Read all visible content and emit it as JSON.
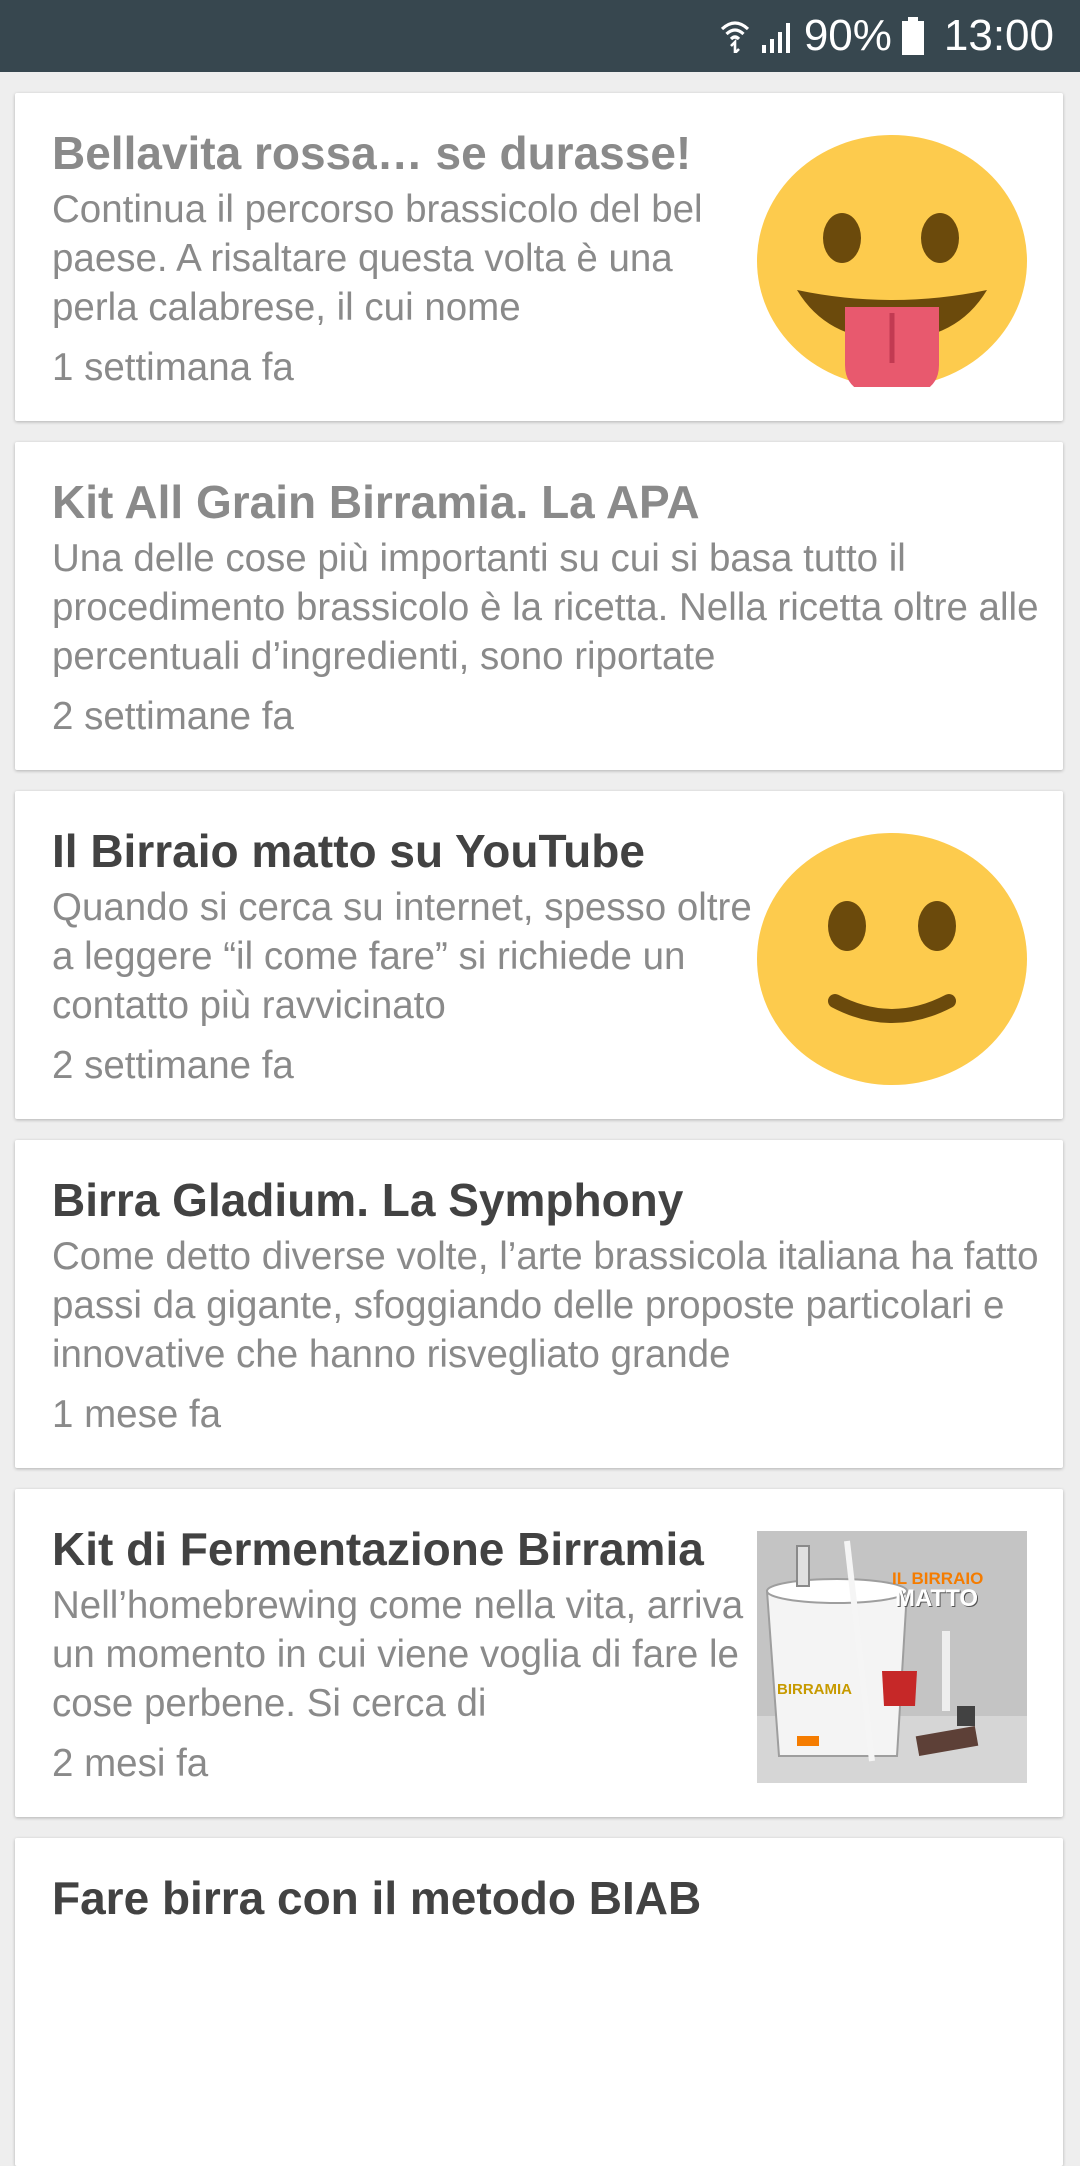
{
  "status_bar": {
    "battery": "90%",
    "time": "13:00"
  },
  "articles": [
    {
      "title": "Bellavita rossa… se durasse!",
      "excerpt": "Continua il percorso brassicolo del bel paese. A risaltare questa volta è una perla calabrese, il cui nome",
      "date": "1 settimana fa",
      "thumbnail": "tongue-emoji-icon",
      "read": true
    },
    {
      "title": "Kit All Grain Birramia. La APA",
      "excerpt": "Una delle cose più importanti su cui si basa tutto il procedimento brassicolo è la ricetta. Nella ricetta oltre alle percentuali d’ingredienti, sono riportate",
      "date": "2 settimane fa",
      "read": true
    },
    {
      "title": "Il Birraio matto su YouTube",
      "excerpt": "Quando si cerca su internet, spesso oltre a leggere “il come fare” si richiede un contatto più ravvicinato",
      "date": "2 settimane fa",
      "thumbnail": "smile-emoji-icon",
      "read": false
    },
    {
      "title": "Birra Gladium. La Symphony",
      "excerpt": "Come detto diverse volte, l’arte brassicola italiana ha fatto passi da gigante, sfoggiando delle proposte particolari e innovative che hanno risvegliato grande",
      "date": "1 mese fa",
      "read": false
    },
    {
      "title": "Kit di Fermentazione Birramia",
      "excerpt": "Nell’homebrewing come nella vita, arriva un momento in cui viene voglia di fare le cose perbene. Si cerca di",
      "date": "2 mesi fa",
      "thumbnail": "fermentation-kit-photo",
      "photo_text": {
        "logo_line1": "IL BIRRAIO",
        "logo_line2": "MATTO",
        "bucket_brand": "BIRRAMIA"
      },
      "read": false
    },
    {
      "title": "Fare birra con il metodo BIAB",
      "read": false
    }
  ],
  "colors": {
    "status_bar": "#37474f",
    "background": "#eeeeee",
    "card": "#ffffff",
    "title_unread": "#424242",
    "text_grey": "#8a8a8a",
    "emoji_yellow": "#fdcb4d",
    "emoji_features": "#6b4a0c",
    "tongue": "#e8596e"
  }
}
